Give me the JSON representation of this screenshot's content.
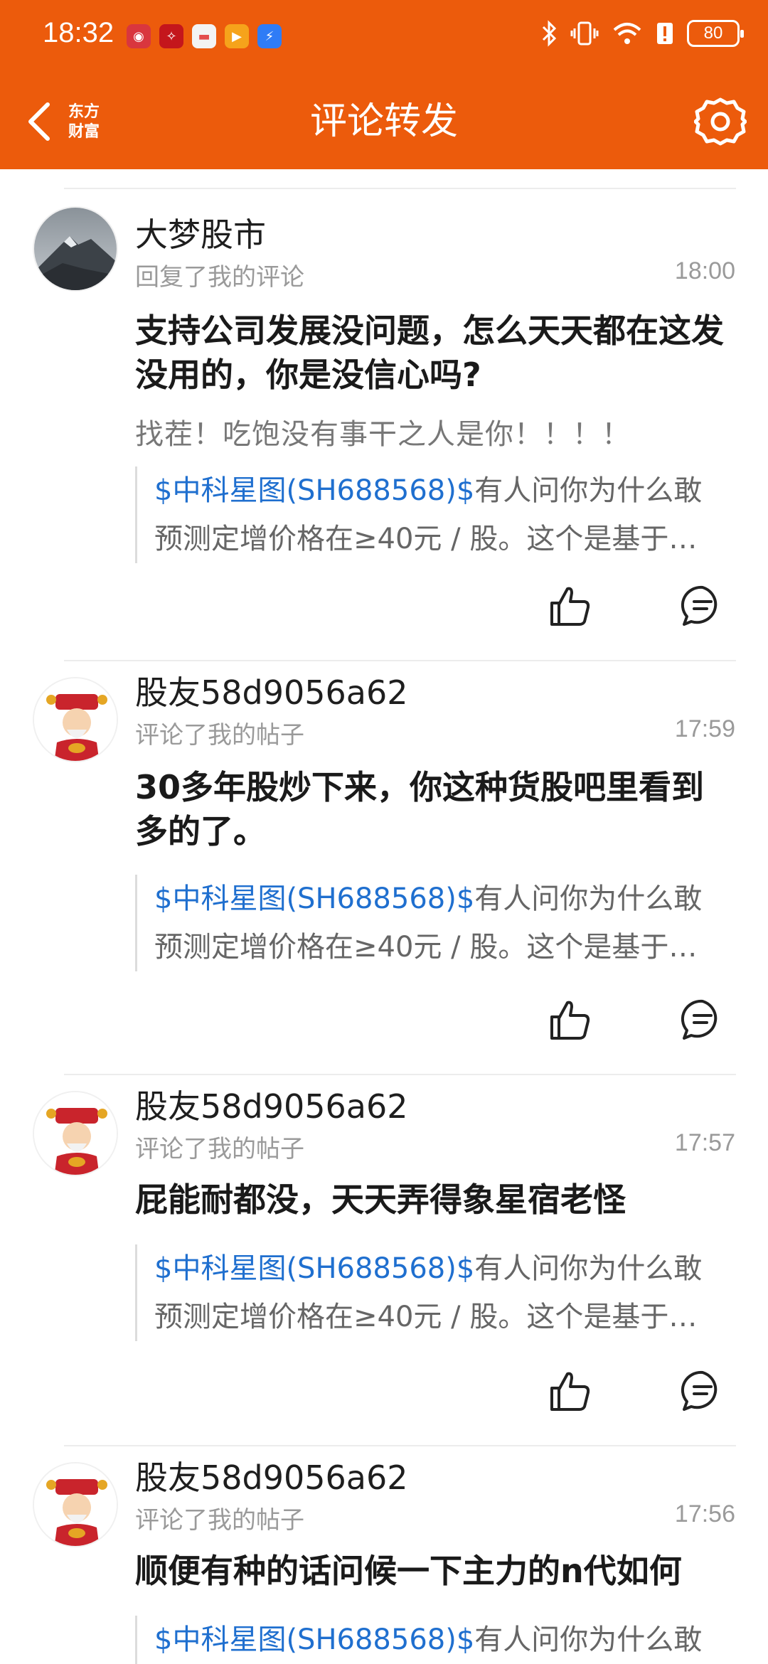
{
  "status_bar": {
    "time": "18:32",
    "battery": "80"
  },
  "title_bar": {
    "title": "评论转发",
    "logo_line1": "东方",
    "logo_line2": "财富"
  },
  "items": [
    {
      "username": "大梦股市",
      "action": "回复了我的评论",
      "time": "18:00",
      "comment": "支持公司发展没问题，怎么天天都在这发没用的，你是没信心吗?",
      "reply": "找茬！吃饱没有事干之人是你！！！！",
      "quote_link": "$中科星图(SH688568)$",
      "quote_text": "有人问你为什么敢",
      "quote_line2": "预测定增价格在≥40元 / 股。这个是基于…"
    },
    {
      "username": "股友58d9056a62",
      "action": "评论了我的帖子",
      "time": "17:59",
      "comment": "30多年股炒下来，你这种货股吧里看到多的了。",
      "quote_link": "$中科星图(SH688568)$",
      "quote_text": "有人问你为什么敢",
      "quote_line2": "预测定增价格在≥40元 / 股。这个是基于…"
    },
    {
      "username": "股友58d9056a62",
      "action": "评论了我的帖子",
      "time": "17:57",
      "comment": "屁能耐都没，天天弄得象星宿老怪",
      "quote_link": "$中科星图(SH688568)$",
      "quote_text": "有人问你为什么敢",
      "quote_line2": "预测定增价格在≥40元 / 股。这个是基于…"
    },
    {
      "username": "股友58d9056a62",
      "action": "评论了我的帖子",
      "time": "17:56",
      "comment": "顺便有种的话问候一下主力的n代如何",
      "quote_link": "$中科星图(SH688568)$",
      "quote_text": "有人问你为什么敢"
    }
  ],
  "colors": {
    "brand": "#ec5b0c",
    "link": "#1f6fcf"
  }
}
